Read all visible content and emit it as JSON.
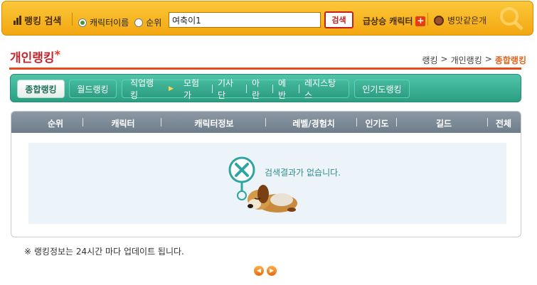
{
  "search": {
    "title": "랭킹 검색",
    "radio_character": "캐릭터이름",
    "radio_rank": "순위",
    "input_value": "여축이1",
    "button": "검색",
    "rising_label": "급상승 캐릭터",
    "rising_badge": "+",
    "guild_label": "병맛같은개"
  },
  "header": {
    "title": "개인랭킹",
    "star": "*",
    "breadcrumb": [
      "랭킹",
      "개인랭킹",
      "종합랭킹"
    ],
    "breadcrumb_sep": ">"
  },
  "tabs": {
    "overall": "종합랭킹",
    "world": "월드랭킹",
    "job": "직업랭킹",
    "jobs": [
      "모험가",
      "기사단",
      "아란",
      "에반",
      "레지스탕스"
    ],
    "popularity": "인기도랭킹"
  },
  "table": {
    "columns": [
      "순위",
      "캐릭터",
      "캐릭터정보",
      "레벨/경험치",
      "인기도",
      "길드",
      "전체"
    ],
    "empty_message": "검색결과가 없습니다."
  },
  "footer": {
    "note": "※ 랭킹정보는 24시간 마다 업데이트 됩니다.",
    "prev": "◀",
    "next": "▶"
  },
  "colors": {
    "search_bar": "#f3a711",
    "title_red": "#c1272d",
    "accent_orange": "#e64a19",
    "tab_green": "#2c9f83",
    "table_header": "#7a8794",
    "empty_bg": "#edf4f9"
  }
}
